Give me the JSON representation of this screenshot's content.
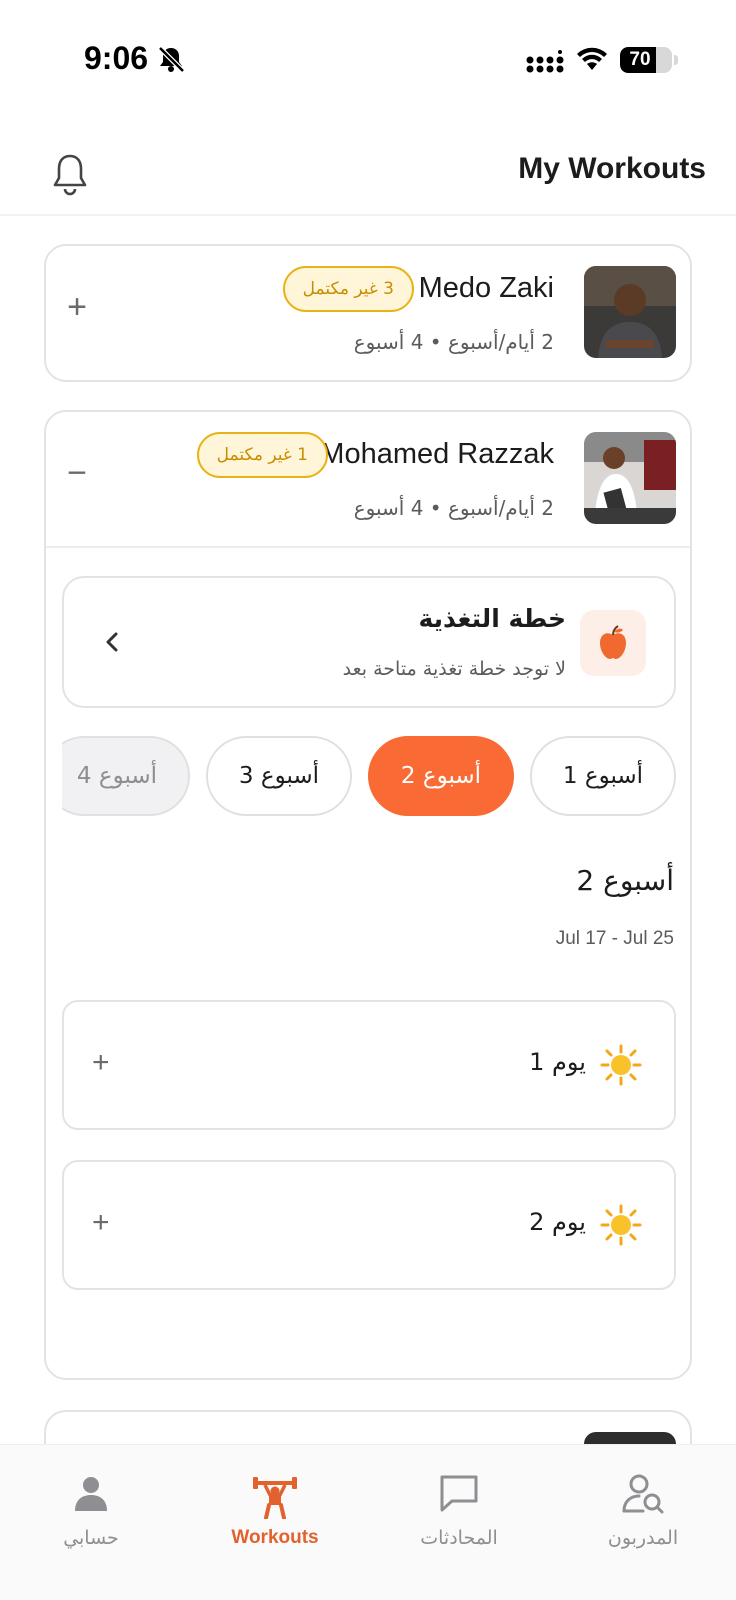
{
  "status_bar": {
    "time": "9:06",
    "battery": "70"
  },
  "header": {
    "title": "My Workouts"
  },
  "coaches": [
    {
      "name": "Medo Zaki",
      "badge": "3 غير مكتمل",
      "meta": "2 أيام/أسبوع • 4 أسبوع",
      "toggle": "+"
    },
    {
      "name": "Mohamed Razzak",
      "badge": "1 غير مكتمل",
      "meta": "2 أيام/أسبوع • 4 أسبوع",
      "toggle": "−"
    }
  ],
  "nutrition": {
    "title": "خطة التغذية",
    "subtitle": "لا توجد خطة تغذية متاحة بعد"
  },
  "weeks": [
    {
      "label": "أسبوع 1",
      "state": "normal"
    },
    {
      "label": "أسبوع 2",
      "state": "active"
    },
    {
      "label": "أسبوع 3",
      "state": "normal"
    },
    {
      "label": "أسبوع 4",
      "state": "faded"
    }
  ],
  "selected_week": {
    "title": "أسبوع 2",
    "range": "Jul 17 - Jul 25"
  },
  "days": [
    {
      "label": "يوم 1",
      "icon": "sun-icon"
    },
    {
      "label": "يوم 2",
      "icon": "sun-icon"
    }
  ],
  "colors": {
    "accent": "#fa6a34",
    "badge_border": "#e8b317",
    "badge_bg": "#fff6d9"
  },
  "bottom_nav": {
    "account": "حسابي",
    "workouts": "Workouts",
    "chats": "المحادثات",
    "coaches": "المدربون"
  }
}
